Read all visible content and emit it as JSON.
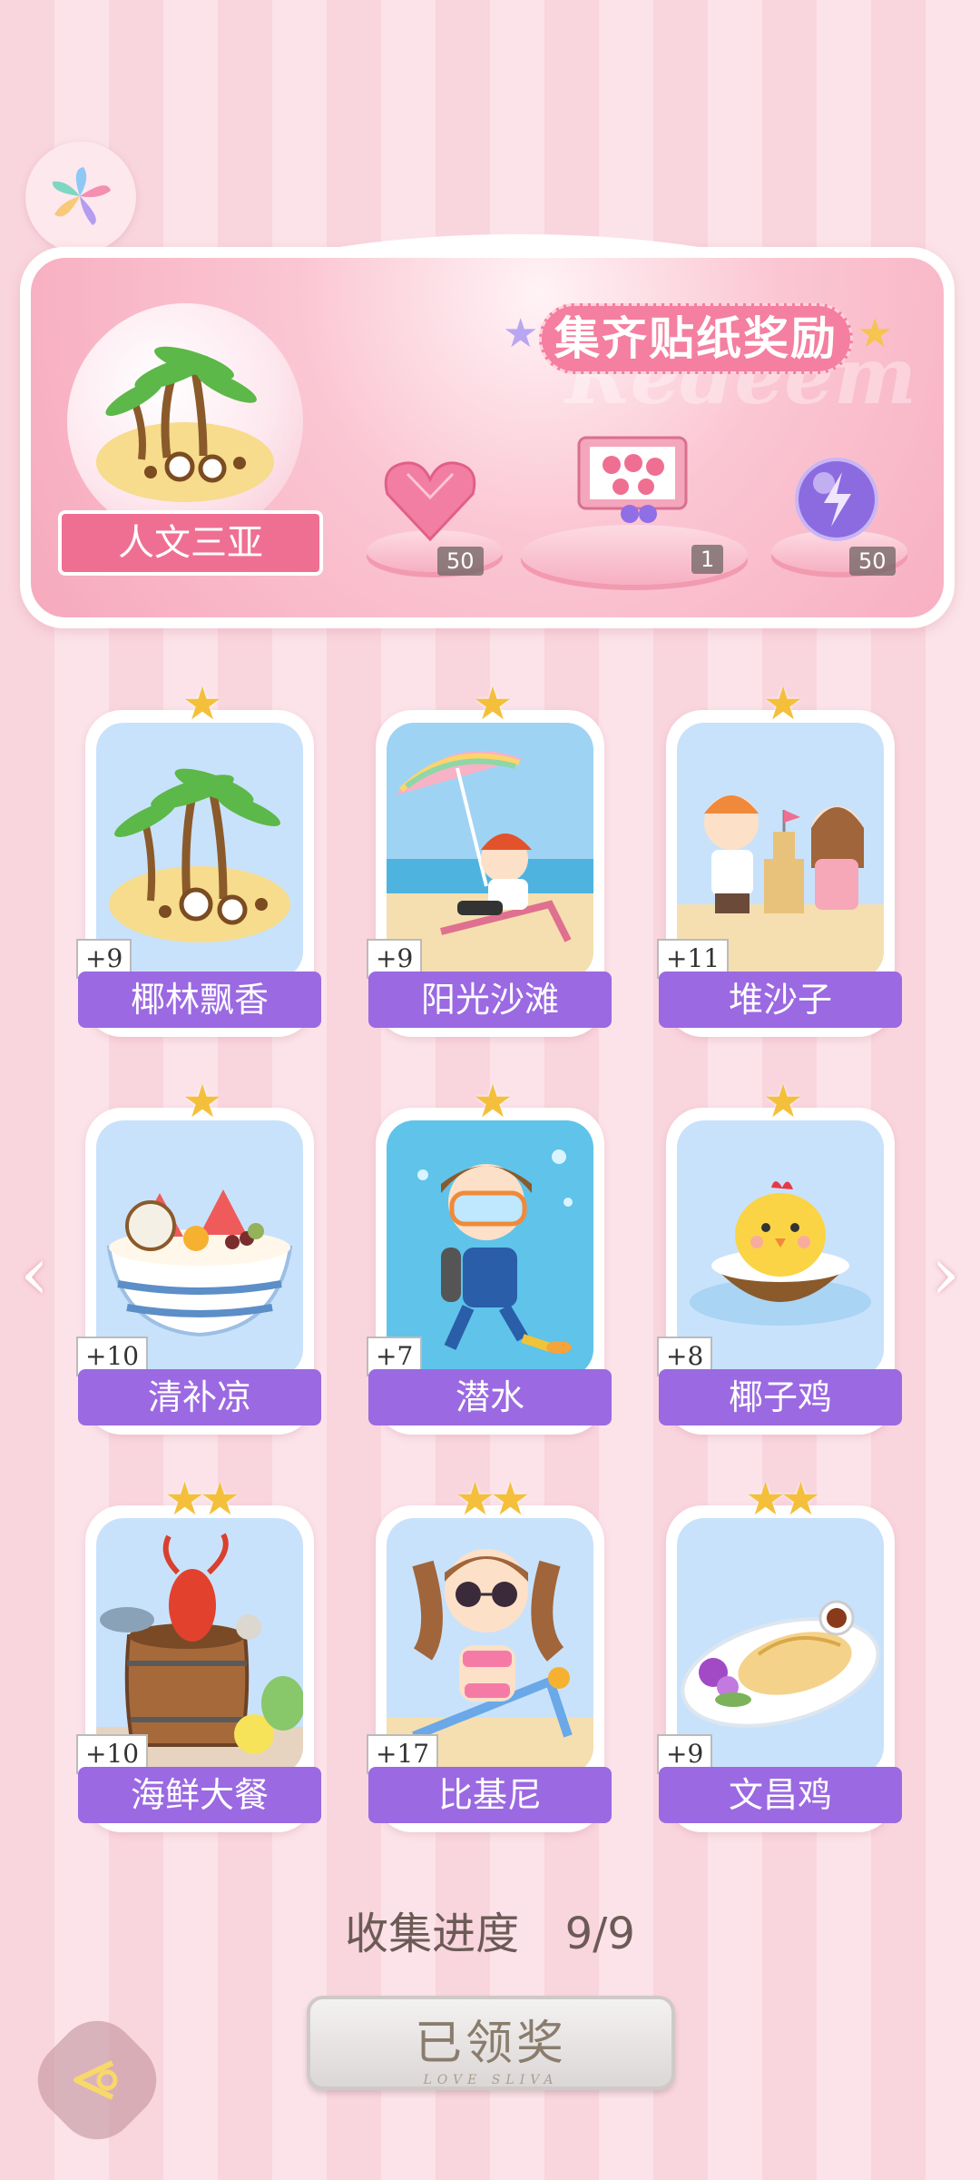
{
  "banner": {
    "title": "集齐贴纸奖励",
    "watermark": "Redeem",
    "location": "人文三亚",
    "rewards": [
      {
        "icon": "pink-heart-gem-icon",
        "count": "50"
      },
      {
        "icon": "gift-box-icon",
        "count": "1"
      },
      {
        "icon": "lightning-orb-icon",
        "count": "50"
      }
    ]
  },
  "cards": [
    {
      "label": "椰林飘香",
      "bonus": "+9",
      "stars": "★",
      "scene": "coconut-island"
    },
    {
      "label": "阳光沙滩",
      "bonus": "+9",
      "stars": "★",
      "scene": "beach-chair"
    },
    {
      "label": "堆沙子",
      "bonus": "+11",
      "stars": "★",
      "scene": "sandcastle"
    },
    {
      "label": "清补凉",
      "bonus": "+10",
      "stars": "★",
      "scene": "dessert-bowl"
    },
    {
      "label": "潜水",
      "bonus": "+7",
      "stars": "★",
      "scene": "diving"
    },
    {
      "label": "椰子鸡",
      "bonus": "+8",
      "stars": "★",
      "scene": "coconut-chick"
    },
    {
      "label": "海鲜大餐",
      "bonus": "+10",
      "stars": "★★",
      "scene": "seafood-barrel"
    },
    {
      "label": "比基尼",
      "bonus": "+17",
      "stars": "★★",
      "scene": "bikini-girl"
    },
    {
      "label": "文昌鸡",
      "bonus": "+9",
      "stars": "★★",
      "scene": "chicken-plate"
    }
  ],
  "progress": {
    "label": "收集进度",
    "value": "9/9"
  },
  "claim": {
    "label": "已领奖",
    "sub": "LOVE SLIVA"
  },
  "colors": {
    "accent": "#9b69e2",
    "pink": "#ef6f92",
    "star": "#f4c03b"
  }
}
